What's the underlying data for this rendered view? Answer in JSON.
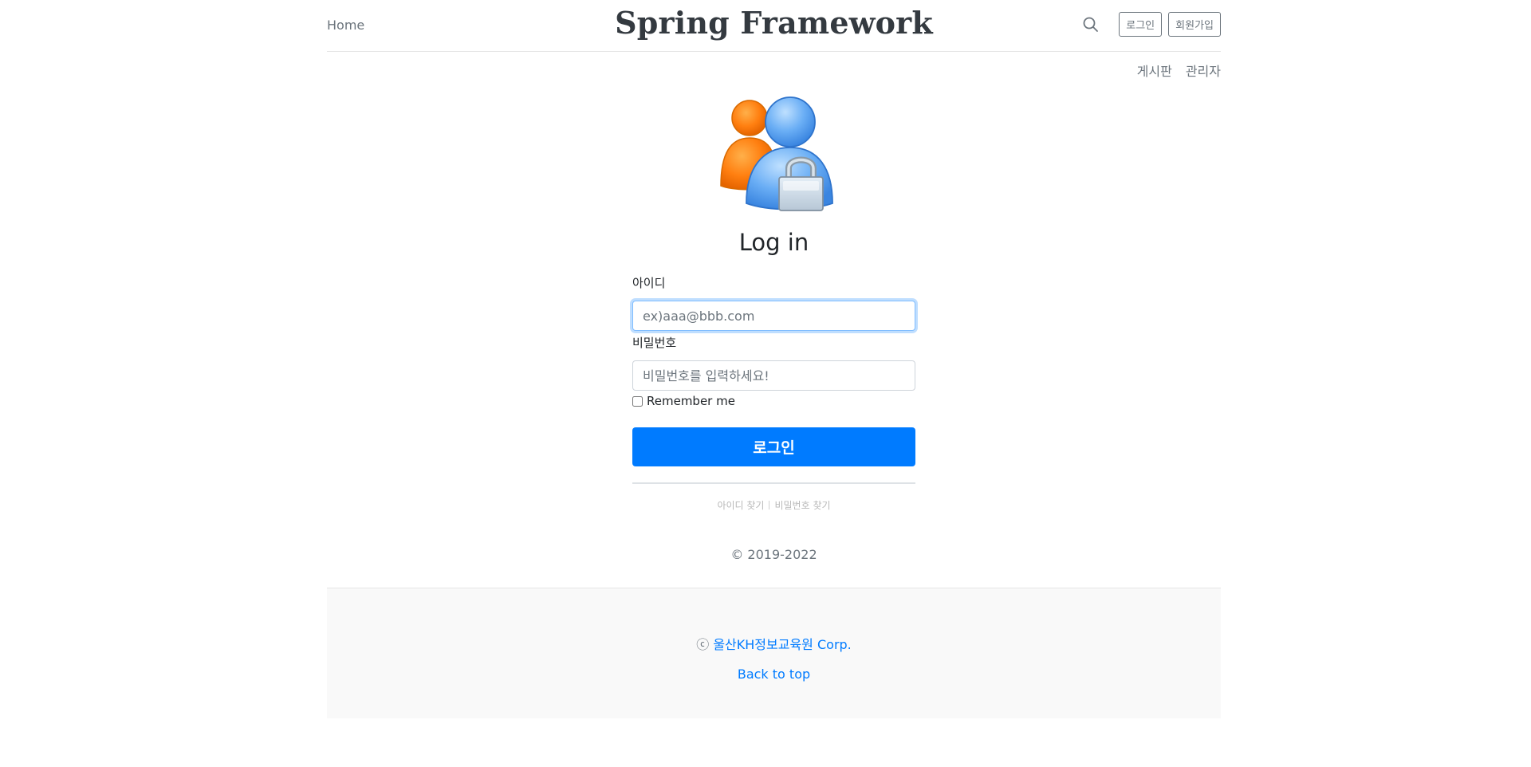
{
  "header": {
    "home": "Home",
    "brand": "Spring Framework",
    "login_button": "로그인",
    "signup_button": "회원가입"
  },
  "nav": {
    "items": [
      "게시판",
      "관리자"
    ]
  },
  "login": {
    "title": "Log in",
    "id_label": "아이디",
    "id_placeholder": "ex)aaa@bbb.com",
    "pw_label": "비밀번호",
    "pw_placeholder": "비밀번호를 입력하세요!",
    "remember": "Remember me",
    "submit": "로그인",
    "find_id": "아이디 찾기",
    "find_pw": "비밀번호 찾기",
    "copyright": "© 2019-2022"
  },
  "footer": {
    "corp_symbol": "ⓒ",
    "corp_name": "울산KH정보교육원 Corp.",
    "back_to_top": "Back to top"
  },
  "colors": {
    "primary": "#007bff",
    "muted": "#6c757d",
    "footer_bg": "#f9f9f9"
  },
  "icons": [
    "search-icon",
    "users-lock-icon"
  ]
}
